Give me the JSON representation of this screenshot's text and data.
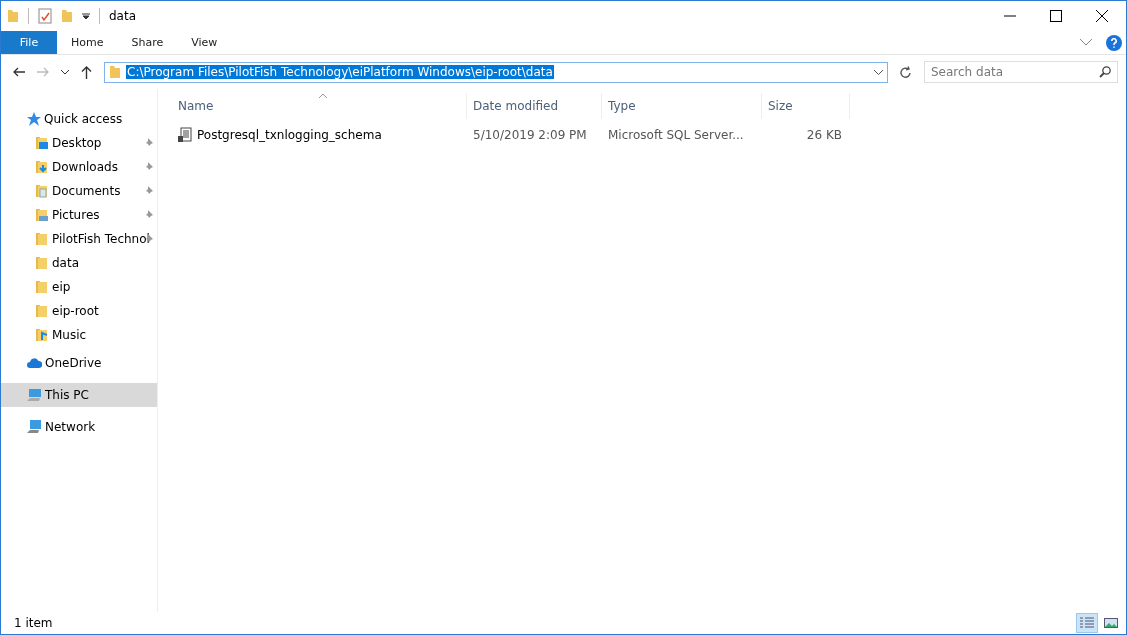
{
  "window": {
    "title": "data"
  },
  "ribbon": {
    "tabs": [
      {
        "label": "File",
        "kind": "file"
      },
      {
        "label": "Home",
        "kind": "tab"
      },
      {
        "label": "Share",
        "kind": "tab"
      },
      {
        "label": "View",
        "kind": "tab"
      }
    ]
  },
  "address": {
    "path": "C:\\Program Files\\PilotFish Technology\\eiPlatform Windows\\eip-root\\data",
    "selected": true
  },
  "search": {
    "placeholder": "Search data"
  },
  "sidebar": {
    "items": [
      {
        "label": "Quick access",
        "kind": "quick",
        "pinned": false,
        "selected": false
      },
      {
        "label": "Desktop",
        "kind": "desktop",
        "pinned": true,
        "selected": false
      },
      {
        "label": "Downloads",
        "kind": "downloads",
        "pinned": true,
        "selected": false
      },
      {
        "label": "Documents",
        "kind": "documents",
        "pinned": true,
        "selected": false
      },
      {
        "label": "Pictures",
        "kind": "pictures",
        "pinned": true,
        "selected": false
      },
      {
        "label": "PilotFish Technol",
        "kind": "folder",
        "pinned": true,
        "selected": false
      },
      {
        "label": "data",
        "kind": "folder",
        "pinned": false,
        "selected": false
      },
      {
        "label": "eip",
        "kind": "folder",
        "pinned": false,
        "selected": false
      },
      {
        "label": "eip-root",
        "kind": "folder",
        "pinned": false,
        "selected": false
      },
      {
        "label": "Music",
        "kind": "music",
        "pinned": false,
        "selected": false
      },
      {
        "label": "OneDrive",
        "kind": "cloud",
        "pinned": false,
        "selected": false
      },
      {
        "label": "This PC",
        "kind": "pc",
        "pinned": false,
        "selected": true
      },
      {
        "label": "Network",
        "kind": "network",
        "pinned": false,
        "selected": false
      }
    ]
  },
  "table": {
    "columns": [
      {
        "label": "Name",
        "sorted": true
      },
      {
        "label": "Date modified",
        "sorted": false
      },
      {
        "label": "Type",
        "sorted": false
      },
      {
        "label": "Size",
        "sorted": false
      }
    ],
    "rows": [
      {
        "name": "Postgresql_txnlogging_schema",
        "date": "5/10/2019 2:09 PM",
        "type": "Microsoft SQL Server...",
        "size": "26 KB"
      }
    ]
  },
  "status_bar": {
    "count": "1 item",
    "views": [
      {
        "kind": "details",
        "selected": true
      },
      {
        "kind": "tiles",
        "selected": false
      }
    ]
  }
}
